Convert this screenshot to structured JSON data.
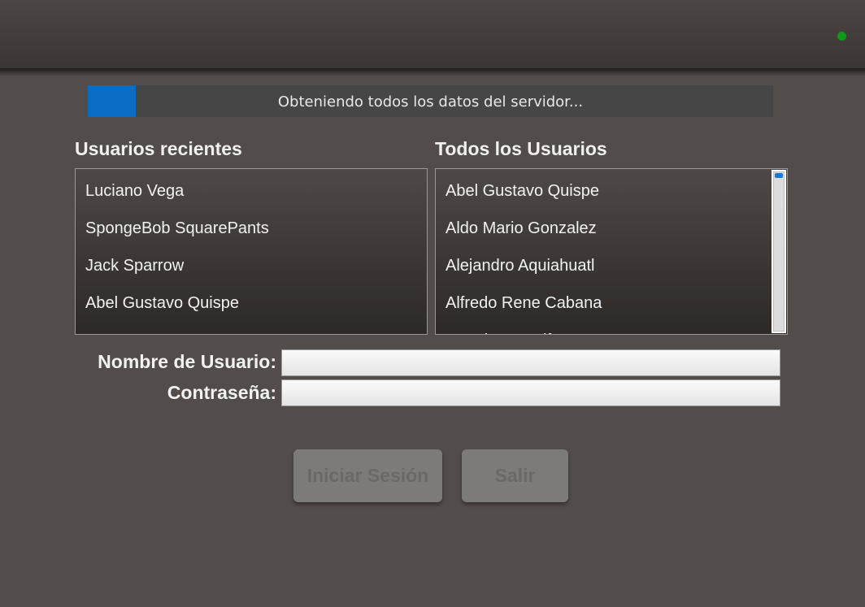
{
  "header": {
    "status_color": "#11991a"
  },
  "progress": {
    "fraction": 0.07,
    "message": "Obteniendo todos los datos del servidor...",
    "fill_color": "#0b6cc3"
  },
  "recent_users": {
    "title": "Usuarios recientes",
    "items": [
      "Luciano Vega",
      "SpongeBob SquarePants",
      "Jack Sparrow",
      "Abel Gustavo Quispe"
    ]
  },
  "all_users": {
    "title": "Todos los Usuarios",
    "items": [
      "Abel Gustavo Quispe",
      "Aldo Mario Gonzalez",
      "Alejandro Aquiahuatl",
      "Alfredo Rene Cabana",
      "Americo Arnulfo Zarate"
    ]
  },
  "login": {
    "username_label": "Nombre de Usuario:",
    "username_value": "",
    "password_label": "Contraseña:",
    "password_value": ""
  },
  "buttons": {
    "login_label": "Iniciar Sesión",
    "exit_label": "Salir"
  }
}
